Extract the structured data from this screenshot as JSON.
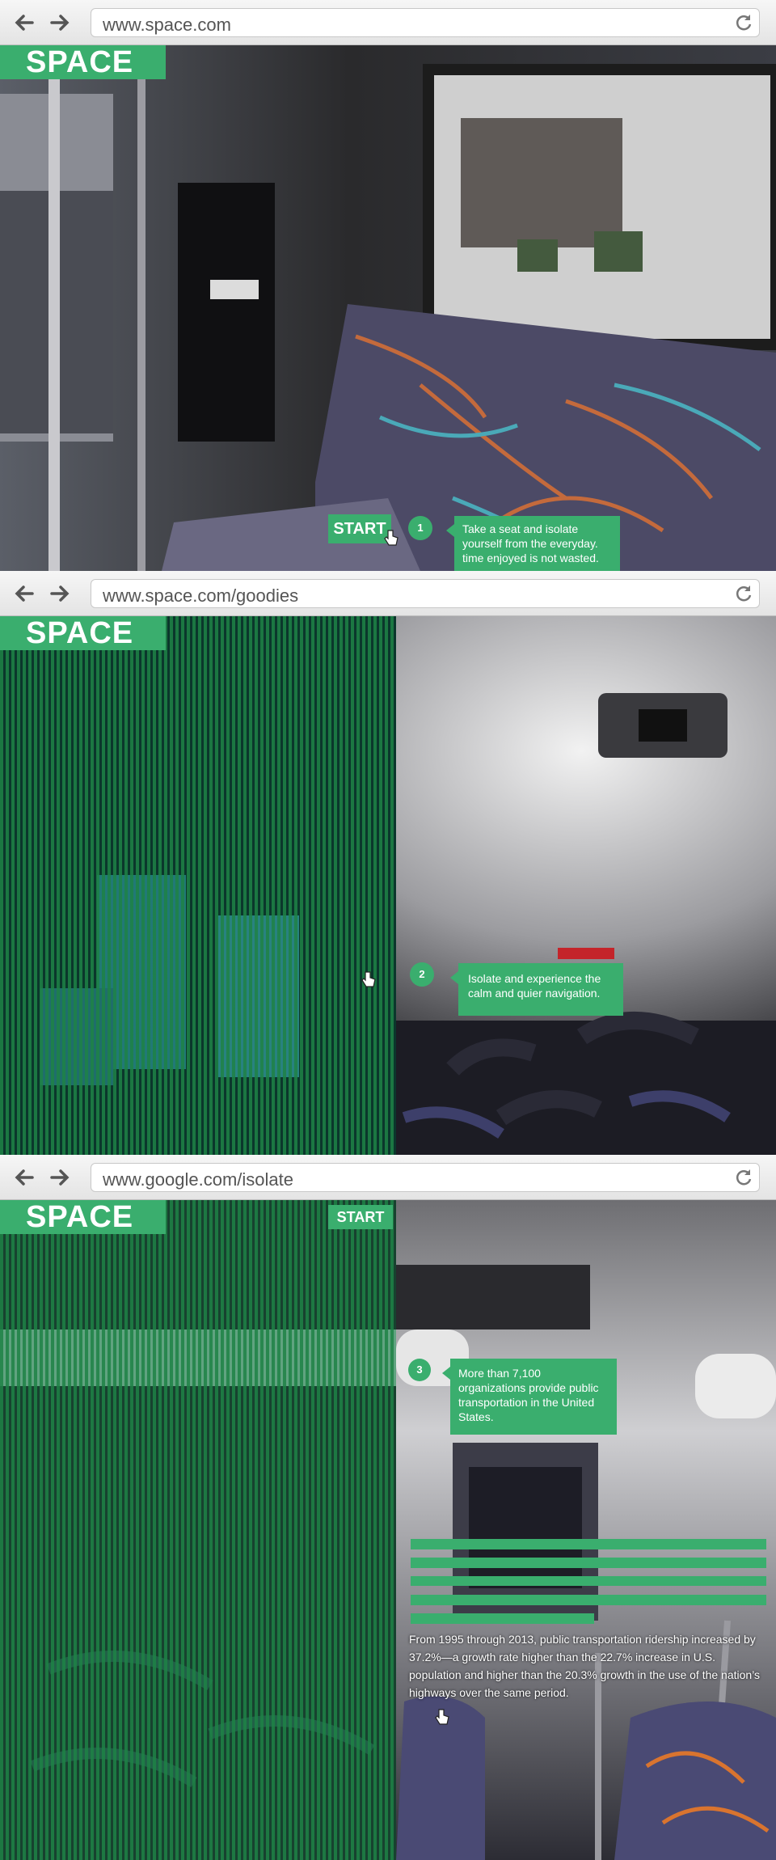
{
  "panels": [
    {
      "url": "www.space.com",
      "logo": "SPACE",
      "start_label": "START",
      "step_number": "1",
      "callout": "Take a seat and isolate yourself from the everyday. time enjoyed is not wasted."
    },
    {
      "url": "www.space.com/goodies",
      "logo": "SPACE",
      "step_number": "2",
      "callout": "Isolate and experience the calm and quier navigation."
    },
    {
      "url": "www.google.com/isolate",
      "logo": "SPACE",
      "start_label": "START",
      "step_number": "3",
      "callout": "More than 7,100 organizations provide public transportation in the United States.",
      "paragraph": "From 1995 through 2013, public transportation ridership increased by 37.2%—a growth rate higher than the 22.7% increase in U.S. population and higher than the 20.3% growth in the use of the nation’s highways over the same period."
    }
  ],
  "colors": {
    "accent": "#3aae6e",
    "toolbar": "#ececec"
  }
}
